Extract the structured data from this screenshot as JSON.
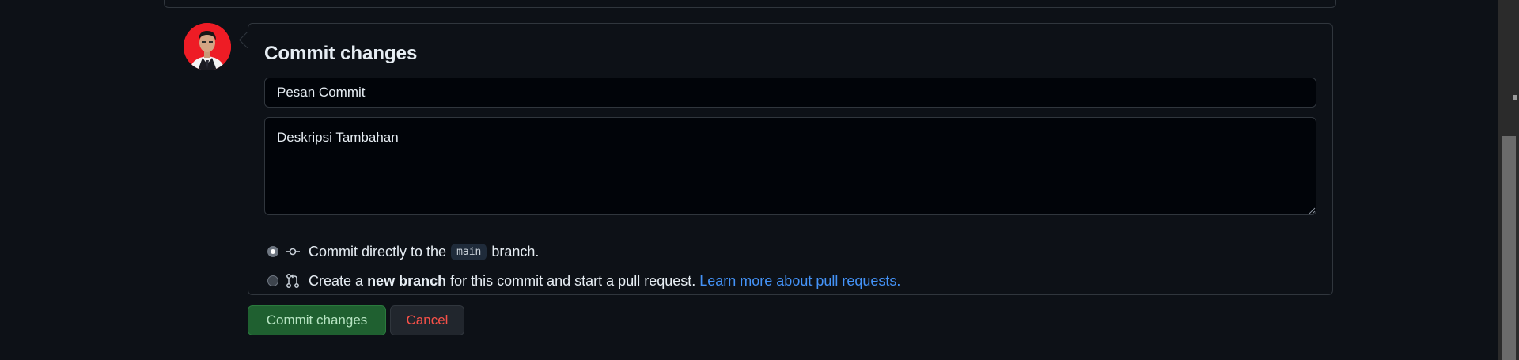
{
  "form": {
    "title": "Commit changes",
    "commit_message_placeholder": "Pesan Commit",
    "description_placeholder": "Deskripsi Tambahan"
  },
  "options": {
    "direct": {
      "prefix": "Commit directly to the",
      "branch": "main",
      "suffix": "branch.",
      "selected": true,
      "icon": "git-commit-icon"
    },
    "new_branch": {
      "prefix": "Create a",
      "bold": "new branch",
      "suffix": "for this commit and start a pull request.",
      "link": "Learn more about pull requests.",
      "selected": false,
      "icon": "git-pull-request-icon"
    }
  },
  "buttons": {
    "commit": "Commit changes",
    "cancel": "Cancel"
  },
  "colors": {
    "background": "#0d1117",
    "border": "#30363d",
    "link": "#4493f8",
    "commit_button": "#1f6030",
    "cancel_text": "#f85149",
    "avatar_bg": "#ee1c25"
  }
}
